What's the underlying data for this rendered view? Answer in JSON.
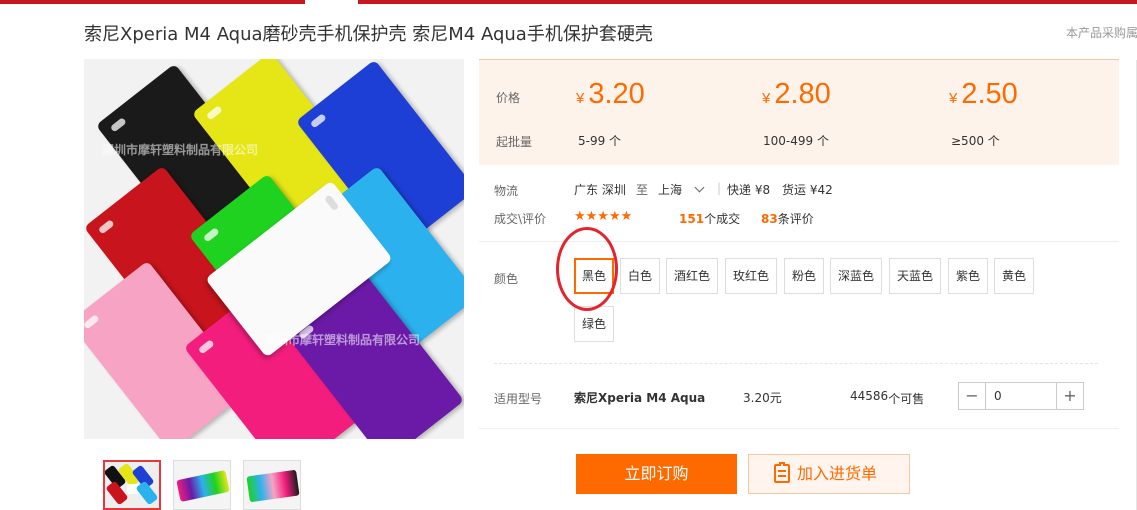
{
  "product_title": "索尼Xperia M4 Aqua磨砂壳手机保护壳 索尼M4 Aqua手机保护套硬壳",
  "side_notice": "本产品采购属",
  "watermark": "深圳市摩轩塑料制品有限公司",
  "price_section": {
    "price_label": "价格",
    "qty_label": "起批量",
    "currency": "¥",
    "tiers": [
      {
        "price": "3.20",
        "range": "5-99 个"
      },
      {
        "price": "2.80",
        "range": "100-499 个"
      },
      {
        "price": "2.50",
        "range": "≥500 个"
      }
    ]
  },
  "logistics": {
    "label": "物流",
    "from": "广东 深圳",
    "to_word": "至",
    "destination": "上海",
    "express": "快递 ¥8",
    "freight": "货运 ¥42"
  },
  "reviews": {
    "label": "成交\\评价",
    "stars": "★★★★★",
    "rating": 5,
    "deals_count": "151",
    "deals_suffix": "个成交",
    "reviews_count": "83",
    "reviews_suffix": "条评价"
  },
  "color": {
    "label": "颜色",
    "selected": "黑色",
    "options": [
      "黑色",
      "白色",
      "酒红色",
      "玫红色",
      "粉色",
      "深蓝色",
      "天蓝色",
      "紫色",
      "黄色",
      "绿色"
    ]
  },
  "model_row": {
    "label": "适用型号",
    "model": "索尼Xperia M4 Aqua",
    "price": "3.20元",
    "stock": "44586",
    "stock_suffix": "个可售",
    "quantity": "0",
    "minus": "−",
    "plus": "+"
  },
  "actions": {
    "buy_now": "立即订购",
    "add_to_list": "加入进货单"
  },
  "colors": {
    "accent": "#ff6a00",
    "brand_red": "#c81623",
    "price_bg": "#fdf3ea"
  }
}
